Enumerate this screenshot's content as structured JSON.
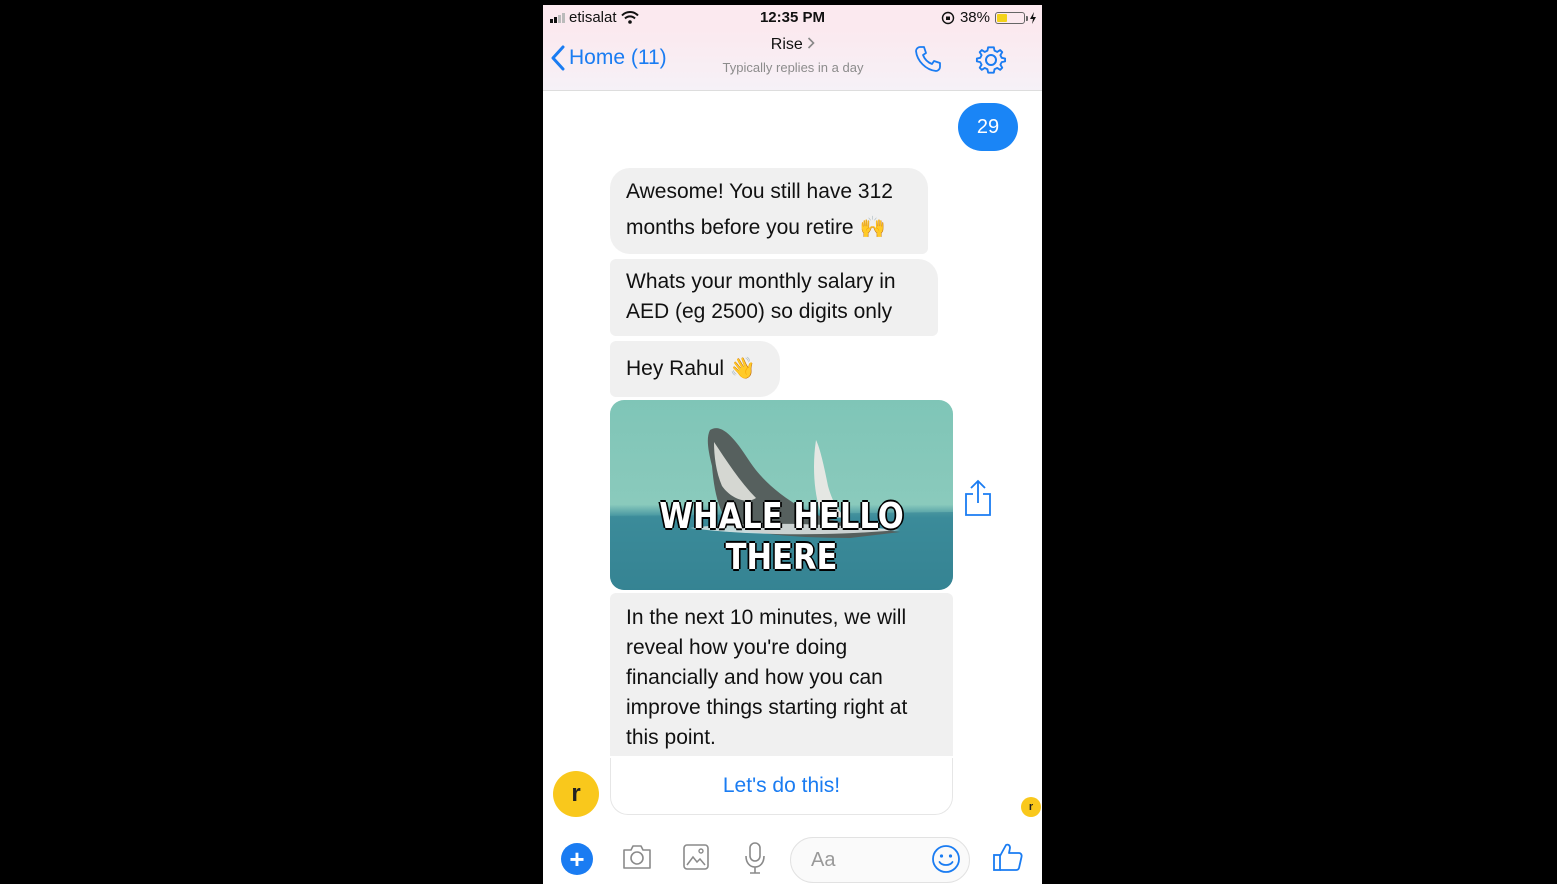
{
  "status_bar": {
    "carrier": "etisalat",
    "time": "12:35 PM",
    "battery": "38%",
    "battery_level": 0.38
  },
  "nav": {
    "back_label": "Home (11)",
    "title": "Rise",
    "subtitle": "Typically replies in a day"
  },
  "messages": {
    "sent_1": "29",
    "received_1": "Awesome! You still have 312 months before you retire 🙌",
    "received_2": "Whats your monthly salary in AED (eg 2500) so digits only",
    "received_3": "Hey Rahul 👋",
    "gif_caption": "WHALE HELLO THERE",
    "received_4": "In the next 10 minutes, we will reveal how you're doing financially and how you can improve things starting right at this point.",
    "cta_button": "Let's do this!"
  },
  "avatar": {
    "letter": "r"
  },
  "composer": {
    "placeholder": "Aa"
  },
  "colors": {
    "accent": "#1a7cf2",
    "avatar": "#f9c81c",
    "bubble": "#f0f0f0"
  }
}
